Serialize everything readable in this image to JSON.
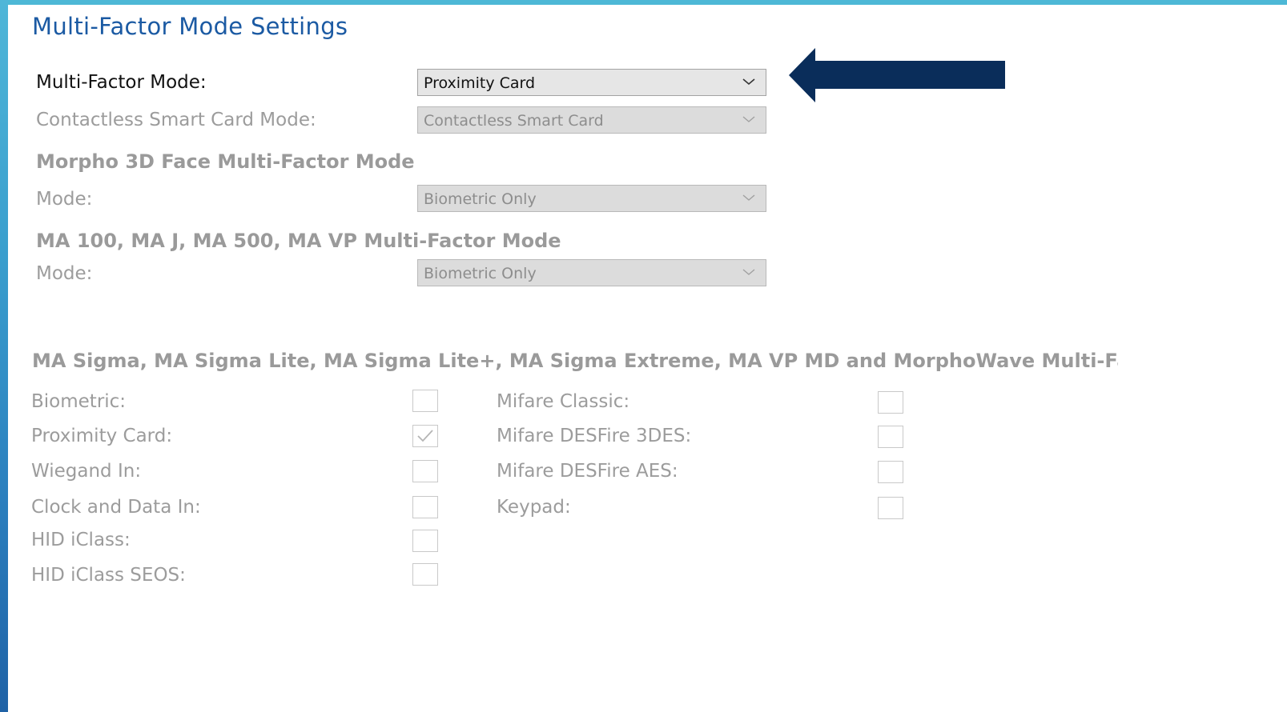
{
  "title": "Multi-Factor Mode Settings",
  "multi_factor_mode": {
    "label": "Multi-Factor Mode:",
    "value": "Proximity Card"
  },
  "contactless": {
    "label": "Contactless Smart Card Mode:",
    "value": "Contactless Smart Card"
  },
  "morpho3d": {
    "heading": "Morpho 3D Face Multi-Factor Mode",
    "mode_label": "Mode:",
    "mode_value": "Biometric Only"
  },
  "ma100": {
    "heading": "MA 100, MA J, MA 500, MA VP Multi-Factor Mode",
    "mode_label": "Mode:",
    "mode_value": "Biometric Only"
  },
  "sigma": {
    "heading": "MA Sigma, MA Sigma Lite, MA Sigma Lite+, MA Sigma Extreme, MA VP MD and MorphoWave Multi-Factor Mode",
    "left_items": [
      {
        "label": "Biometric:",
        "checked": false
      },
      {
        "label": "Proximity Card:",
        "checked": true
      },
      {
        "label": "Wiegand In:",
        "checked": false
      },
      {
        "label": "Clock and Data In:",
        "checked": false
      },
      {
        "label": "HID iClass:",
        "checked": false
      },
      {
        "label": "HID iClass SEOS:",
        "checked": false
      }
    ],
    "right_items": [
      {
        "label": "Mifare Classic:",
        "checked": false
      },
      {
        "label": "Mifare DESFire 3DES:",
        "checked": false
      },
      {
        "label": "Mifare DESFire AES:",
        "checked": false
      },
      {
        "label": "Keypad:",
        "checked": false
      }
    ]
  },
  "colors": {
    "title": "#1b5aa3",
    "arrow": "#0a2d5a",
    "accent_bar": "#4db8d6",
    "disabled_text": "#9c9c9c"
  },
  "icons": {
    "select": "chevron-down-icon",
    "checkbox": "checkmark-icon",
    "pointer": "arrow-left-icon"
  }
}
